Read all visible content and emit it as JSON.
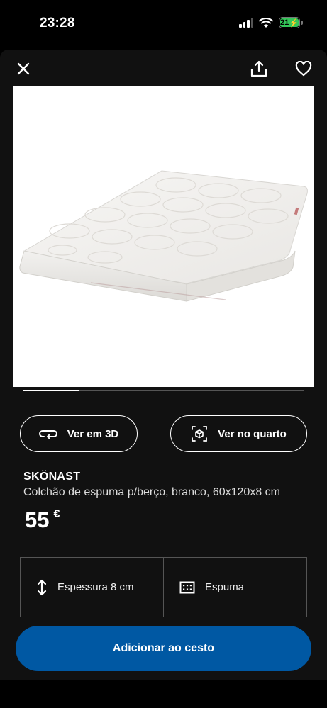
{
  "status_bar": {
    "time": "23:28",
    "battery_level": "21",
    "icons": [
      "cellular-signal-icon",
      "wifi-icon",
      "battery-charging-icon"
    ]
  },
  "toolbar": {
    "icons": [
      "close-icon",
      "share-icon",
      "heart-icon"
    ]
  },
  "gallery": {
    "image": "white foam crib mattress with quilted oval pattern",
    "progress_fraction": 0.2
  },
  "actions": {
    "view_3d_label": "Ver em 3D",
    "view_3d_icon": "rotate-3d-icon",
    "view_room_label": "Ver no quarto",
    "view_room_icon": "ar-cube-icon"
  },
  "product": {
    "name": "SKÖNAST",
    "description": "Colchão de espuma p/berço, branco, 60x120x8 cm",
    "price": "55",
    "currency": "€"
  },
  "features": [
    {
      "icon": "vertical-arrows-icon",
      "label": "Espessura 8 cm"
    },
    {
      "icon": "foam-grid-icon",
      "label": "Espuma"
    }
  ],
  "cart": {
    "add_label": "Adicionar ao cesto"
  },
  "colors": {
    "background": "#111111",
    "accent": "#0058a3",
    "battery": "#34c759"
  }
}
